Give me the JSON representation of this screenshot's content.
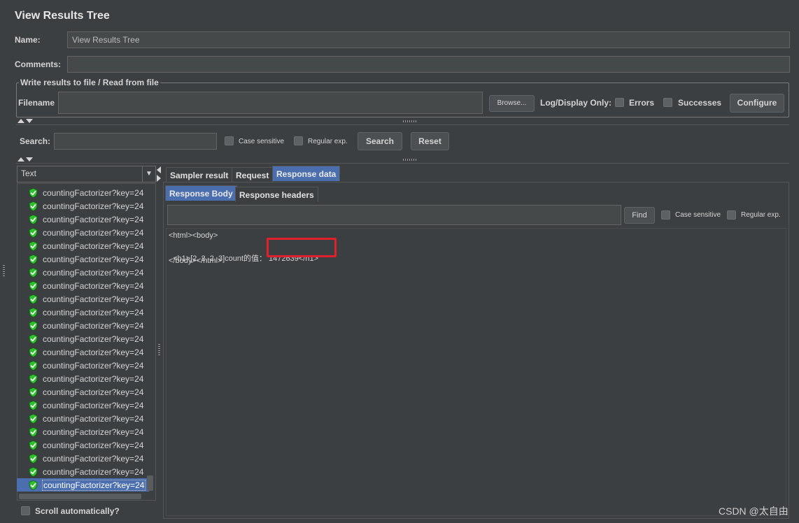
{
  "panel": {
    "title": "View Results Tree",
    "name_label": "Name:",
    "name_value": "View Results Tree",
    "comments_label": "Comments:",
    "comments_value": ""
  },
  "file_section": {
    "title": "Write results to file / Read from file",
    "filename_label": "Filename",
    "filename_value": "",
    "browse_label": "Browse...",
    "log_display_label": "Log/Display Only:",
    "errors_label": "Errors",
    "successes_label": "Successes",
    "configure_label": "Configure"
  },
  "search": {
    "label": "Search:",
    "value": "",
    "case_sensitive_label": "Case sensitive",
    "regex_label": "Regular exp.",
    "search_button": "Search",
    "reset_button": "Reset"
  },
  "renderer": {
    "selected": "Text"
  },
  "tree": {
    "items": [
      "countingFactorizer?key=24",
      "countingFactorizer?key=24",
      "countingFactorizer?key=24",
      "countingFactorizer?key=24",
      "countingFactorizer?key=24",
      "countingFactorizer?key=24",
      "countingFactorizer?key=24",
      "countingFactorizer?key=24",
      "countingFactorizer?key=24",
      "countingFactorizer?key=24",
      "countingFactorizer?key=24",
      "countingFactorizer?key=24",
      "countingFactorizer?key=24",
      "countingFactorizer?key=24",
      "countingFactorizer?key=24",
      "countingFactorizer?key=24",
      "countingFactorizer?key=24",
      "countingFactorizer?key=24",
      "countingFactorizer?key=24",
      "countingFactorizer?key=24",
      "countingFactorizer?key=24",
      "countingFactorizer?key=24",
      "countingFactorizer?key=24"
    ],
    "selected_index": 22,
    "scroll_auto_label": "Scroll automatically?"
  },
  "tabs": {
    "main": [
      "Sampler result",
      "Request",
      "Response data"
    ],
    "main_active": 2,
    "sub": [
      "Response Body",
      "Response headers"
    ],
    "sub_active": 0
  },
  "find": {
    "value": "",
    "button": "Find",
    "case_sensitive_label": "Case sensitive",
    "regex_label": "Regular exp."
  },
  "response_body": {
    "line1": "<html><body>",
    "line2_prefix": "<h1>[2, 2, 2, 3]count的值：",
    "line2_highlight": "1472639</h1>",
    "line3": "</body></html>"
  },
  "watermark": "CSDN @太自由",
  "colors": {
    "accent": "#4b6eaf",
    "highlight_box": "#e0202a",
    "success_icon": "#2fbf2f"
  }
}
